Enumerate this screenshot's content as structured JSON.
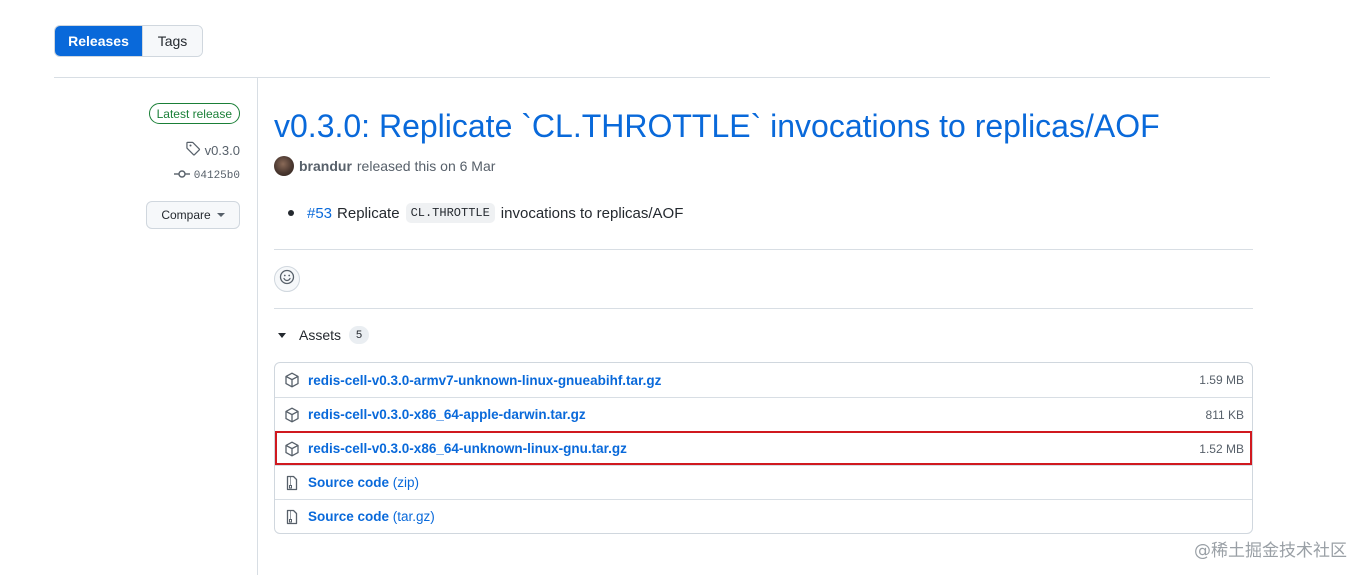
{
  "tabs": {
    "releases": "Releases",
    "tags": "Tags"
  },
  "sidebar": {
    "latest_badge": "Latest release",
    "tag": "v0.3.0",
    "commit": "04125b0",
    "compare": "Compare",
    "icons": {
      "tag": "tag-icon",
      "commit": "git-commit-icon"
    }
  },
  "release": {
    "title": "v0.3.0: Replicate `CL.THROTTLE` invocations to replicas/AOF",
    "author": "brandur",
    "released_text": "released this on 6 Mar",
    "notes": {
      "issue": "#53",
      "text_before": "Replicate",
      "code": "CL.THROTTLE",
      "text_after": "invocations to replicas/AOF"
    }
  },
  "assets": {
    "heading": "Assets",
    "count": "5",
    "files": [
      {
        "name": "redis-cell-v0.3.0-armv7-unknown-linux-gnueabihf.tar.gz",
        "size": "1.59 MB",
        "icon": "package-icon"
      },
      {
        "name": "redis-cell-v0.3.0-x86_64-apple-darwin.tar.gz",
        "size": "811 KB",
        "icon": "package-icon"
      },
      {
        "name": "redis-cell-v0.3.0-x86_64-unknown-linux-gnu.tar.gz",
        "size": "1.52 MB",
        "icon": "package-icon",
        "highlighted": true
      }
    ],
    "sources": [
      {
        "label": "Source code",
        "format": "(zip)",
        "icon": "file-zip-icon"
      },
      {
        "label": "Source code",
        "format": "(tar.gz)",
        "icon": "file-zip-icon"
      }
    ]
  },
  "watermark": "@稀土掘金技术社区",
  "colors": {
    "accent": "#0969da",
    "latest_green": "#1a7f37",
    "highlight_red": "#d0191f"
  }
}
